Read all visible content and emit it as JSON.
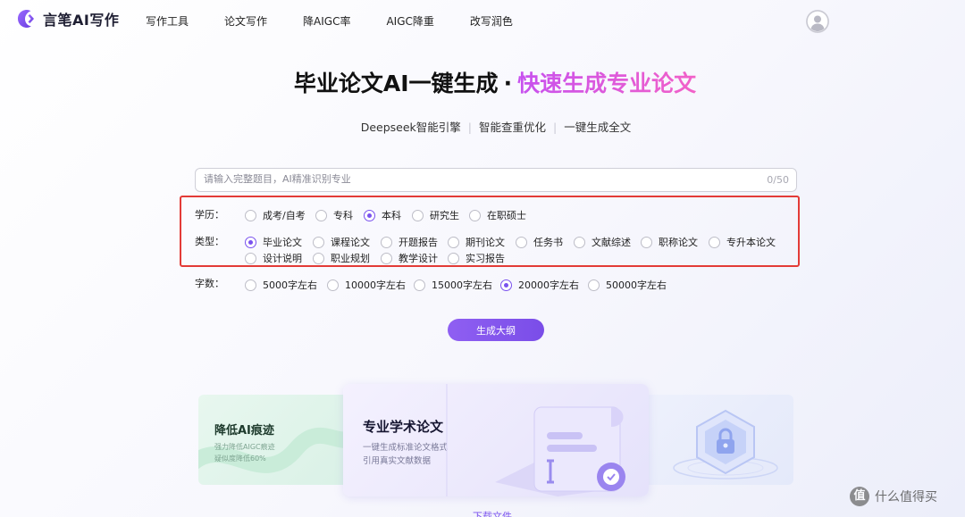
{
  "brand": {
    "name": "言笔AI写作",
    "accent": "#7a52ee"
  },
  "nav": {
    "items": [
      {
        "label": "写作工具"
      },
      {
        "label": "论文写作"
      },
      {
        "label": "降AIGC率"
      },
      {
        "label": "AIGC降重"
      },
      {
        "label": "改写润色"
      }
    ]
  },
  "hero": {
    "title_main": "毕业论文AI一键生成",
    "title_sep": "·",
    "title_highlight": "快速生成专业论文",
    "features": [
      "Deepseek智能引擎",
      "智能查重优化",
      "一键生成全文"
    ]
  },
  "form": {
    "title_input": {
      "value": "",
      "placeholder": "请输入完整题目，AI精准识别专业",
      "counter": "0/50"
    },
    "education": {
      "label": "学历：",
      "selected": "本科",
      "options": [
        "成考/自考",
        "专科",
        "本科",
        "研究生",
        "在职硕士"
      ]
    },
    "type": {
      "label": "类型：",
      "selected": "毕业论文",
      "options": [
        "毕业论文",
        "课程论文",
        "开题报告",
        "期刊论文",
        "任务书",
        "文献综述",
        "职称论文",
        "专升本论文",
        "设计说明",
        "职业规划",
        "教学设计",
        "实习报告"
      ]
    },
    "word_count": {
      "label": "字数：",
      "selected": "20000字左右",
      "options": [
        "5000字左右",
        "10000字左右",
        "15000字左右",
        "20000字左右",
        "50000字左右"
      ]
    },
    "generate_button": "生成大纲"
  },
  "cards": {
    "left": {
      "title": "降低AI痕迹",
      "desc1": "强力降低AIGC痕迹",
      "desc2": "疑似度降低60%"
    },
    "center": {
      "title": "专业学术论文",
      "desc1": "一键生成标准论文格式",
      "desc2": "引用真实文献数据"
    },
    "right": {
      "icon": "lock-shield-icon"
    }
  },
  "bottom_link": "下载文件",
  "watermark": {
    "glyph": "值",
    "text": "什么值得买"
  }
}
